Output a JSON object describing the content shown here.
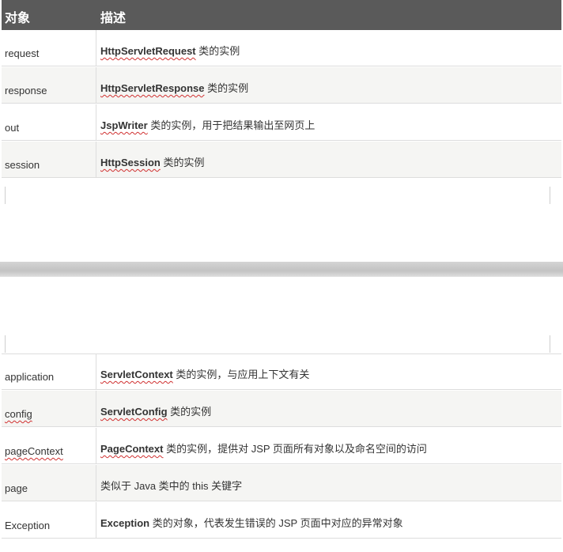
{
  "header": {
    "object_label": "对象",
    "description_label": "描述"
  },
  "rows_top": [
    {
      "object": "request",
      "class_name": "HttpServletRequest",
      "rest": " 类的实例",
      "squiggle_object": false
    },
    {
      "object": "response",
      "class_name": "HttpServletResponse",
      "rest": " 类的实例",
      "squiggle_object": false
    },
    {
      "object": "out",
      "class_name": "JspWriter",
      "rest": " 类的实例，用于把结果输出至网页上",
      "squiggle_object": false
    },
    {
      "object": "session",
      "class_name": "HttpSession",
      "rest": " 类的实例",
      "squiggle_object": false
    }
  ],
  "rows_bottom": [
    {
      "object": "application",
      "class_name": "ServletContext",
      "rest": " 类的实例，与应用上下文有关",
      "squiggle_object": false
    },
    {
      "object": "config",
      "class_name": "ServletConfig",
      "rest": " 类的实例",
      "squiggle_object": true
    },
    {
      "object": "pageContext",
      "class_name": "PageContext",
      "rest": " 类的实例，提供对 JSP 页面所有对象以及命名空间的访问",
      "squiggle_object": true
    },
    {
      "object": "page",
      "class_name": "",
      "rest": "类似于 Java 类中的 this 关键字",
      "squiggle_object": false
    },
    {
      "object": "Exception",
      "class_name": "Exception",
      "rest": " 类的对象，代表发生错误的 JSP 页面中对应的异常对象",
      "squiggle_object": false
    }
  ]
}
